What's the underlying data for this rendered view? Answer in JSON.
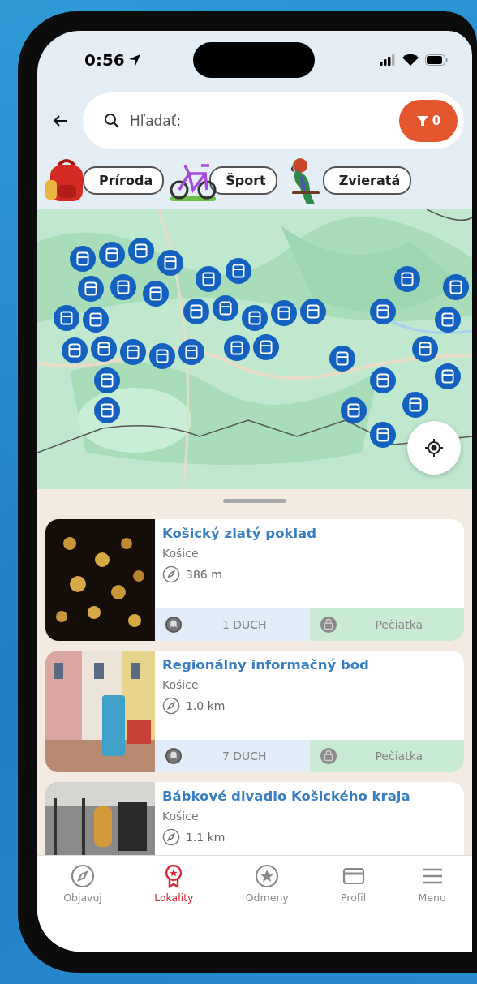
{
  "status_bar": {
    "time": "0:56"
  },
  "search": {
    "placeholder": "Hľadať:",
    "filter_count": "0"
  },
  "categories": [
    {
      "label": "Príroda"
    },
    {
      "label": "Šport"
    },
    {
      "label": "Zvieratá"
    }
  ],
  "cards": [
    {
      "title": "Košický zlatý poklad",
      "city": "Košice",
      "distance": "386 m",
      "ghosts": "1 DUCH",
      "stamp": "Pečiatka"
    },
    {
      "title": "Regionálny informačný bod",
      "city": "Košice",
      "distance": "1.0 km",
      "ghosts": "7 DUCH",
      "stamp": "Pečiatka"
    },
    {
      "title": "Bábkové divadlo Košického kraja",
      "city": "Košice",
      "distance": "1.1 km"
    }
  ],
  "nav": [
    {
      "label": "Objavuj",
      "selected": false
    },
    {
      "label": "Lokality",
      "selected": true
    },
    {
      "label": "Odmeny",
      "selected": false
    },
    {
      "label": "Profil",
      "selected": false
    },
    {
      "label": "Menu",
      "selected": false
    }
  ]
}
